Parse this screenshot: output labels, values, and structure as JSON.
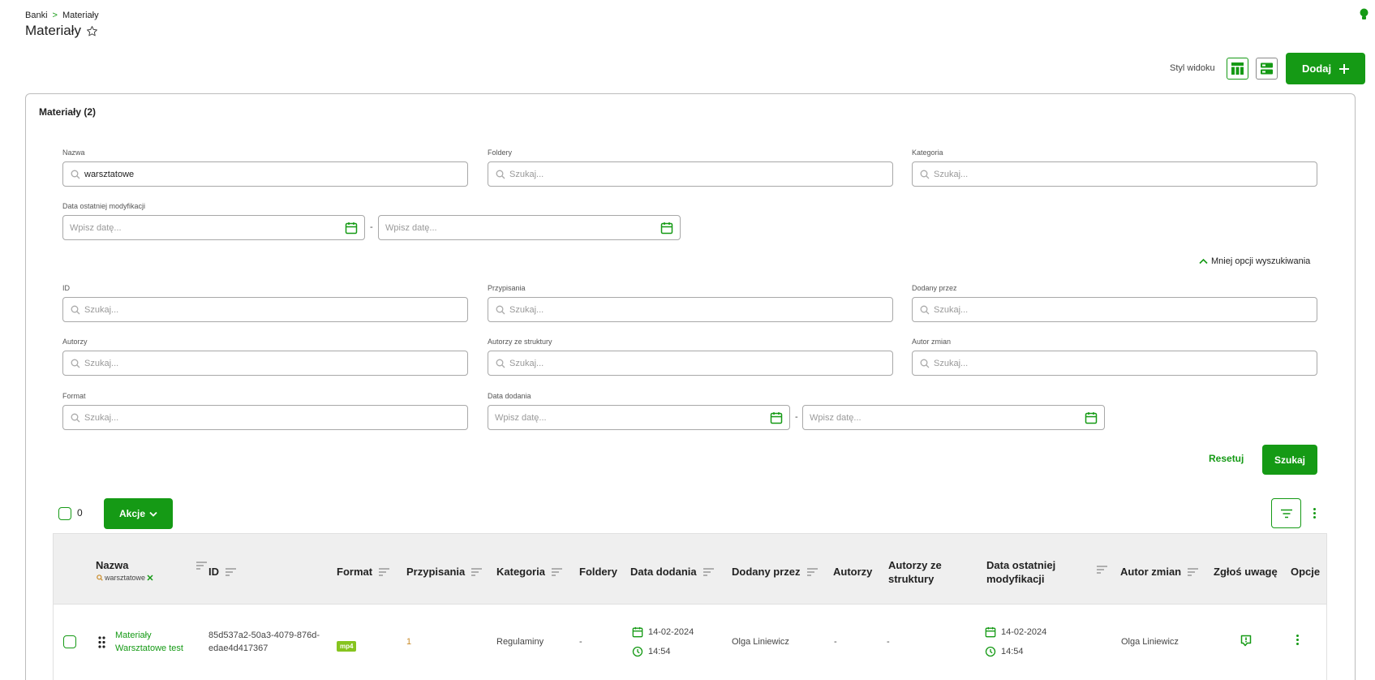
{
  "breadcrumb": {
    "root": "Banki",
    "separator": ">",
    "current": "Materiały"
  },
  "page_title": "Materiały",
  "toolbar": {
    "view_style_label": "Styl widoku",
    "add_label": "Dodaj"
  },
  "panel": {
    "title": "Materiały (2)"
  },
  "filters": {
    "name": {
      "label": "Nazwa",
      "value": "warsztatowe"
    },
    "folders": {
      "label": "Foldery",
      "placeholder": "Szukaj..."
    },
    "category": {
      "label": "Kategoria",
      "placeholder": "Szukaj..."
    },
    "last_modified": {
      "label": "Data ostatniej modyfikacji",
      "from_placeholder": "Wpisz datę...",
      "to_placeholder": "Wpisz datę..."
    },
    "less_options": "Mniej opcji wyszukiwania",
    "id": {
      "label": "ID",
      "placeholder": "Szukaj..."
    },
    "assignments": {
      "label": "Przypisania",
      "placeholder": "Szukaj..."
    },
    "added_by": {
      "label": "Dodany przez",
      "placeholder": "Szukaj..."
    },
    "authors": {
      "label": "Autorzy",
      "placeholder": "Szukaj..."
    },
    "structure_authors": {
      "label": "Autorzy ze struktury",
      "placeholder": "Szukaj..."
    },
    "change_author": {
      "label": "Autor zmian",
      "placeholder": "Szukaj..."
    },
    "format": {
      "label": "Format",
      "placeholder": "Szukaj..."
    },
    "date_added": {
      "label": "Data dodania",
      "from_placeholder": "Wpisz datę...",
      "to_placeholder": "Wpisz datę..."
    },
    "reset_label": "Resetuj",
    "search_label": "Szukaj"
  },
  "table_toolbar": {
    "selected_count": "0",
    "actions_label": "Akcje"
  },
  "table": {
    "columns": {
      "name": "Nazwa",
      "name_filter": "warsztatowe",
      "id": "ID",
      "format": "Format",
      "assignments": "Przypisania",
      "category": "Kategoria",
      "folders": "Foldery",
      "date_added": "Data dodania",
      "added_by": "Dodany przez",
      "authors": "Autorzy",
      "structure_authors_1": "Autorzy ze",
      "structure_authors_2": "struktury",
      "last_modified_1": "Data ostatniej",
      "last_modified_2": "modyfikacji",
      "change_author": "Autor zmian",
      "report": "Zgłoś uwagę",
      "options": "Opcje"
    },
    "rows": [
      {
        "name_1": "Materiały",
        "name_2": "Warsztatowe test",
        "id_1": "85d537a2-50a3-4079-876d-",
        "id_2": "edae4d417367",
        "format": "mp4",
        "assignments": "1",
        "category": "Regulaminy",
        "folders": "-",
        "date_added": "14-02-2024",
        "time_added": "14:54",
        "added_by": "Olga Liniewicz",
        "authors": "-",
        "structure_authors": "-",
        "modified_date": "14-02-2024",
        "modified_time": "14:54",
        "change_author": "Olga Liniewicz"
      }
    ]
  },
  "colors": {
    "accent": "#159a15",
    "mp4_badge": "#86c41f",
    "assignments": "#c98b2a"
  }
}
